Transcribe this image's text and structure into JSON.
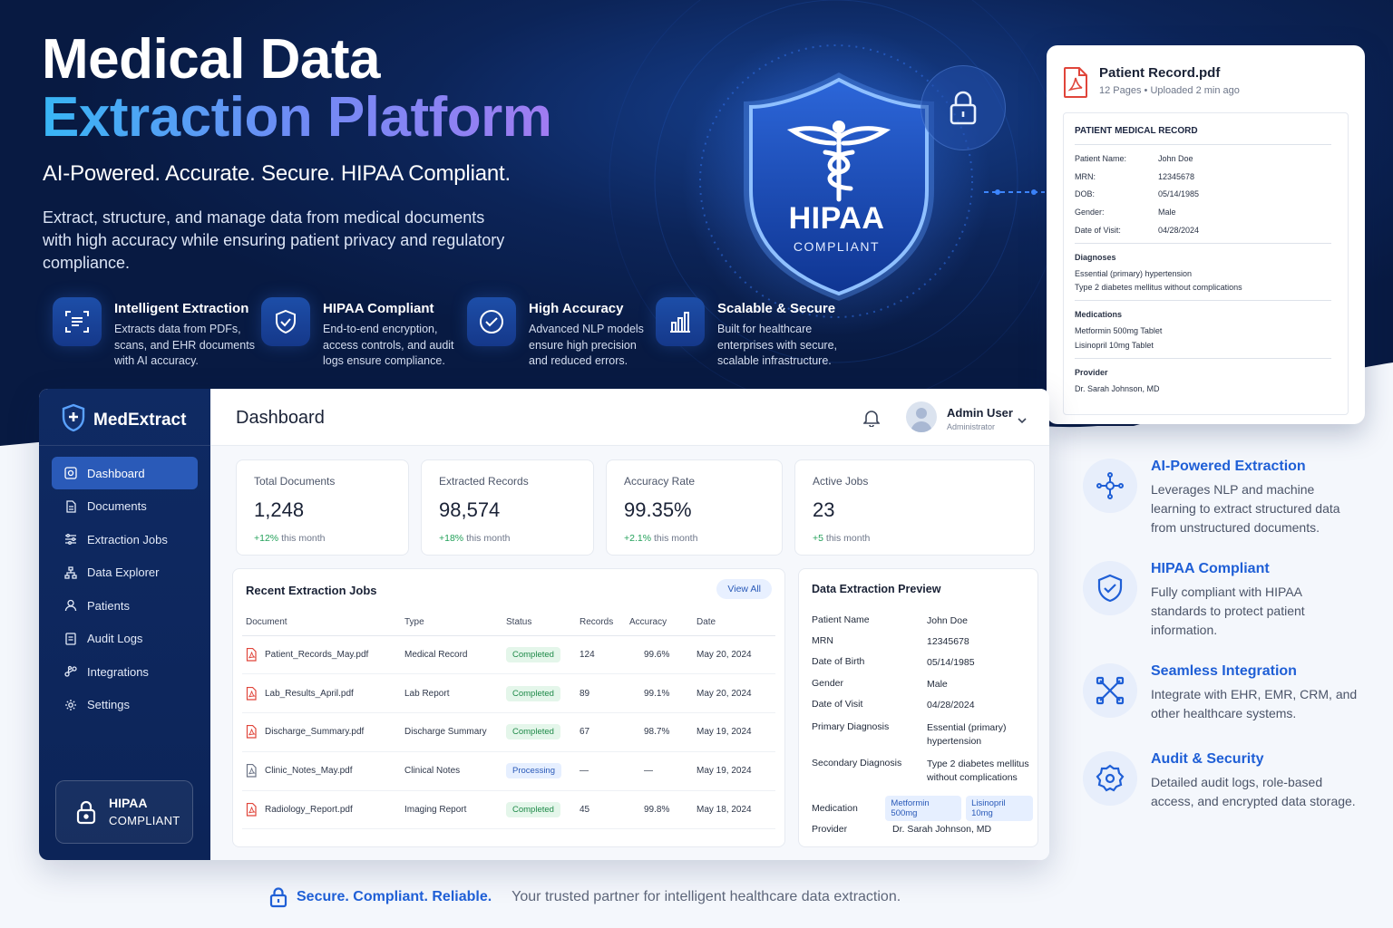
{
  "hero": {
    "title_line1": "Medical Data",
    "title_line2": "Extraction Platform",
    "tagline": "AI-Powered. Accurate. Secure. HIPAA Compliant.",
    "description": "Extract, structure, and manage data from medical documents with high accuracy while ensuring patient privacy and regulatory compliance.",
    "features": [
      {
        "icon": "scan-text-icon",
        "title": "Intelligent Extraction",
        "desc": "Extracts data from PDFs, scans, and EHR documents with AI accuracy."
      },
      {
        "icon": "shield-check-icon",
        "title": "HIPAA Compliant",
        "desc": "End-to-end encryption, access controls, and audit logs ensure compliance."
      },
      {
        "icon": "check-circle-icon",
        "title": "High Accuracy",
        "desc": "Advanced NLP models ensure high precision and reduced errors."
      },
      {
        "icon": "bar-chart-icon",
        "title": "Scalable & Secure",
        "desc": "Built for healthcare enterprises with secure, scalable infrastructure."
      }
    ],
    "shield_title": "HIPAA",
    "shield_subtitle": "COMPLIANT"
  },
  "patient_record": {
    "file_name": "Patient Record.pdf",
    "file_meta": "12 Pages • Uploaded 2 min ago",
    "doc_title": "PATIENT MEDICAL RECORD",
    "fields": [
      {
        "k": "Patient Name:",
        "v": "John Doe"
      },
      {
        "k": "MRN:",
        "v": "12345678"
      },
      {
        "k": "DOB:",
        "v": "05/14/1985"
      },
      {
        "k": "Gender:",
        "v": "Male"
      },
      {
        "k": "Date of Visit:",
        "v": "04/28/2024"
      }
    ],
    "diagnoses_head": "Diagnoses",
    "diagnoses": [
      "Essential (primary) hypertension",
      "Type 2 diabetes mellitus without complications"
    ],
    "medications_head": "Medications",
    "medications": [
      "Metformin 500mg Tablet",
      "Lisinopril 10mg Tablet"
    ],
    "provider_head": "Provider",
    "provider": "Dr. Sarah Johnson, MD"
  },
  "dashboard": {
    "brand": "MedExtract",
    "nav": [
      {
        "label": "Dashboard",
        "icon": "dashboard-icon",
        "active": true
      },
      {
        "label": "Documents",
        "icon": "document-icon",
        "active": false
      },
      {
        "label": "Extraction Jobs",
        "icon": "sliders-icon",
        "active": false
      },
      {
        "label": "Data Explorer",
        "icon": "hierarchy-icon",
        "active": false
      },
      {
        "label": "Patients",
        "icon": "user-icon",
        "active": false
      },
      {
        "label": "Audit Logs",
        "icon": "log-icon",
        "active": false
      },
      {
        "label": "Integrations",
        "icon": "link-icon",
        "active": false
      },
      {
        "label": "Settings",
        "icon": "gear-icon",
        "active": false
      }
    ],
    "badge_line1": "HIPAA",
    "badge_line2": "COMPLIANT",
    "page_title": "Dashboard",
    "user_name": "Admin User",
    "user_role": "Administrator",
    "stats": [
      {
        "label": "Total Documents",
        "value": "1,248",
        "delta": "+12%",
        "delta_suffix": " this month"
      },
      {
        "label": "Extracted Records",
        "value": "98,574",
        "delta": "+18%",
        "delta_suffix": " this month"
      },
      {
        "label": "Accuracy Rate",
        "value": "99.35%",
        "delta": "+2.1%",
        "delta_suffix": " this month"
      },
      {
        "label": "Active Jobs",
        "value": "23",
        "delta": "+5",
        "delta_suffix": " this month"
      }
    ],
    "jobs_title": "Recent Extraction Jobs",
    "view_all": "View All",
    "columns": [
      "Document",
      "Type",
      "Status",
      "Records",
      "Accuracy",
      "Date"
    ],
    "jobs": [
      {
        "doc": "Patient_Records_May.pdf",
        "type": "Medical Record",
        "status": "Completed",
        "records": "124",
        "accuracy": "99.6%",
        "date": "May 20, 2024",
        "pdf_color": "#e0453a"
      },
      {
        "doc": "Lab_Results_April.pdf",
        "type": "Lab Report",
        "status": "Completed",
        "records": "89",
        "accuracy": "99.1%",
        "date": "May 20, 2024",
        "pdf_color": "#e0453a"
      },
      {
        "doc": "Discharge_Summary.pdf",
        "type": "Discharge Summary",
        "status": "Completed",
        "records": "67",
        "accuracy": "98.7%",
        "date": "May 19, 2024",
        "pdf_color": "#e0453a"
      },
      {
        "doc": "Clinic_Notes_May.pdf",
        "type": "Clinical Notes",
        "status": "Processing",
        "records": "—",
        "accuracy": "—",
        "date": "May 19, 2024",
        "pdf_color": "#6c7486"
      },
      {
        "doc": "Radiology_Report.pdf",
        "type": "Imaging Report",
        "status": "Completed",
        "records": "45",
        "accuracy": "99.8%",
        "date": "May 18, 2024",
        "pdf_color": "#e0453a"
      }
    ],
    "preview_title": "Data Extraction Preview",
    "preview": [
      {
        "k": "Patient Name",
        "v": "John Doe"
      },
      {
        "k": "MRN",
        "v": "12345678"
      },
      {
        "k": "Date of Birth",
        "v": "05/14/1985"
      },
      {
        "k": "Gender",
        "v": "Male"
      },
      {
        "k": "Date of Visit",
        "v": "04/28/2024"
      },
      {
        "k": "Primary Diagnosis",
        "v": "Essential (primary) hypertension"
      },
      {
        "k": "Secondary Diagnosis",
        "v": "Type 2 diabetes mellitus without complications"
      }
    ],
    "medication_label": "Medication",
    "medications": [
      "Metformin 500mg",
      "Lisinopril 10mg"
    ],
    "provider_label": "Provider",
    "provider": "Dr. Sarah Johnson, MD"
  },
  "right_features": [
    {
      "icon": "ai-network-icon",
      "title": "AI-Powered Extraction",
      "desc": "Leverages NLP and machine learning to extract structured data from unstructured documents."
    },
    {
      "icon": "shield-check-icon",
      "title": "HIPAA Compliant",
      "desc": "Fully compliant with HIPAA standards to protect patient information."
    },
    {
      "icon": "integration-icon",
      "title": "Seamless Integration",
      "desc": "Integrate with EHR, EMR, CRM, and other healthcare systems."
    },
    {
      "icon": "gear-security-icon",
      "title": "Audit & Security",
      "desc": "Detailed audit logs, role-based access, and encrypted data storage."
    }
  ],
  "footer": {
    "strong": "Secure. Compliant. Reliable.",
    "text": "Your trusted partner for intelligent healthcare data extraction."
  },
  "colors": {
    "navy": "#0b1e4a",
    "accent": "#1f5fd6",
    "success": "#23a15a"
  }
}
